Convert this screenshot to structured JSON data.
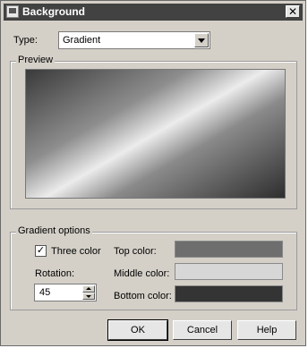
{
  "window": {
    "title": "Background",
    "close_glyph": "✕"
  },
  "type": {
    "label": "Type:",
    "selected": "Gradient"
  },
  "preview": {
    "legend": "Preview"
  },
  "gradient_options": {
    "legend": "Gradient options",
    "three_color_label": "Three color",
    "three_color_checked": "✓",
    "rotation_label": "Rotation:",
    "rotation_value": "45",
    "top_color_label": "Top color:",
    "middle_color_label": "Middle color:",
    "bottom_color_label": "Bottom color:",
    "colors": {
      "top": "#6e6e6e",
      "middle": "#d7d7d7",
      "bottom": "#343434"
    }
  },
  "buttons": {
    "ok": "OK",
    "cancel": "Cancel",
    "help": "Help"
  }
}
